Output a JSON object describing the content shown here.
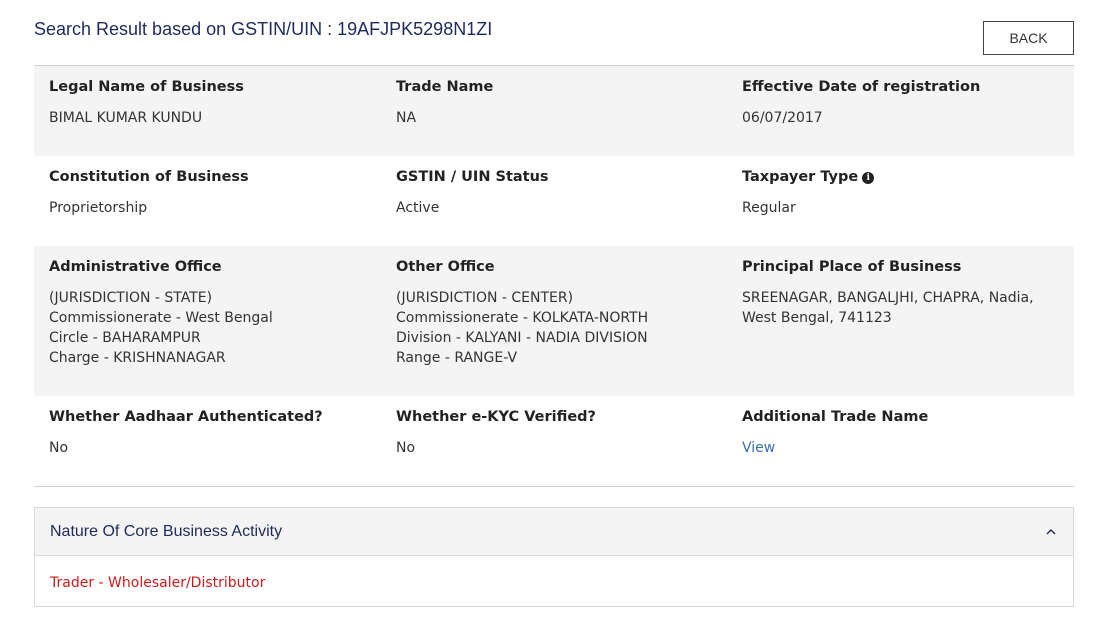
{
  "header": {
    "title": "Search Result based on GSTIN/UIN : 19AFJPK5298N1ZI",
    "back_label": "BACK"
  },
  "details": {
    "legal_name": {
      "label": "Legal Name of Business",
      "value": "BIMAL KUMAR KUNDU"
    },
    "trade_name": {
      "label": "Trade Name",
      "value": "NA"
    },
    "effective_date": {
      "label": "Effective Date of registration",
      "value": "06/07/2017"
    },
    "constitution": {
      "label": "Constitution of Business",
      "value": "Proprietorship"
    },
    "status": {
      "label": "GSTIN / UIN Status",
      "value": "Active"
    },
    "taxpayer_type": {
      "label": "Taxpayer Type",
      "value": "Regular",
      "icon": "info-circle-icon"
    },
    "admin_office": {
      "label": "Administrative Office",
      "lines": [
        "(JURISDICTION - STATE)",
        "Commissionerate - West Bengal",
        "Circle - BAHARAMPUR",
        "Charge - KRISHNANAGAR"
      ]
    },
    "other_office": {
      "label": "Other Office",
      "lines": [
        "(JURISDICTION - CENTER)",
        "Commissionerate - KOLKATA-NORTH",
        "Division - KALYANI - NADIA DIVISION",
        "Range - RANGE-V"
      ]
    },
    "principal_place": {
      "label": "Principal Place of Business",
      "lines": [
        "SREENAGAR, BANGALJHI, CHAPRA, Nadia,",
        "West Bengal, 741123"
      ]
    },
    "aadhaar": {
      "label": "Whether Aadhaar Authenticated?",
      "value": "No"
    },
    "ekyc": {
      "label": "Whether e-KYC Verified?",
      "value": "No"
    },
    "additional_trade": {
      "label": "Additional Trade Name",
      "link": "View"
    }
  },
  "core_activity": {
    "title": "Nature Of Core Business Activity",
    "toggle_icon": "chevron-up-icon",
    "value": "Trader - Wholesaler/Distributor"
  },
  "colors": {
    "title": "#1e2a5c",
    "link": "#3a6eb0",
    "activity": "#d11a1a",
    "shade": "#f4f4f4"
  }
}
